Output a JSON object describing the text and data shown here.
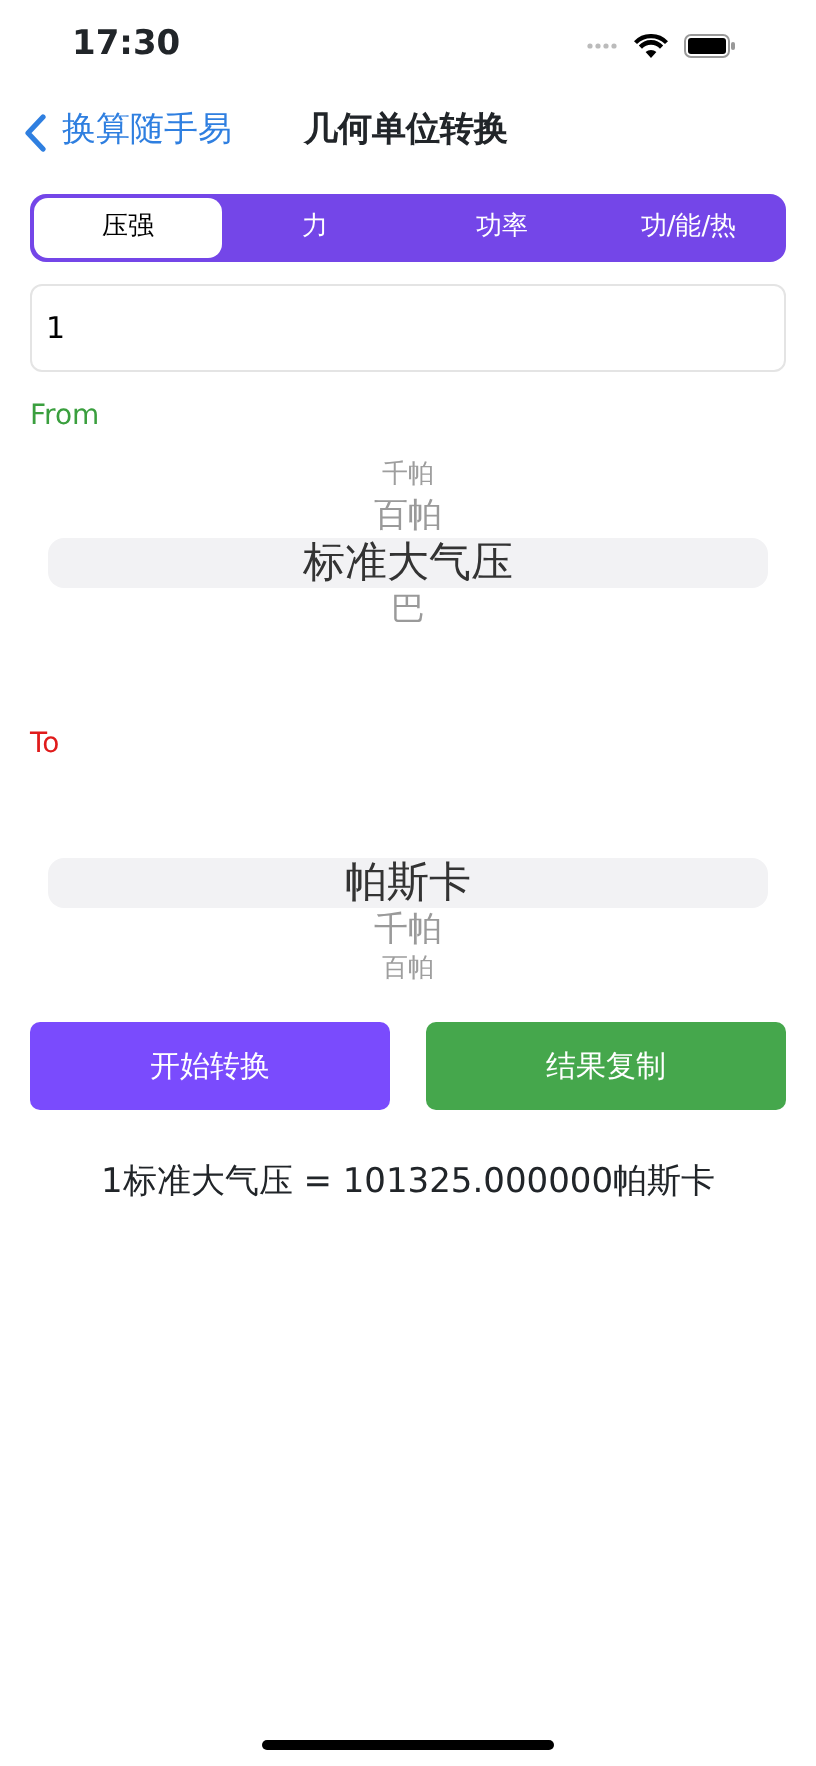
{
  "status_bar": {
    "time": "17:30"
  },
  "nav": {
    "back_label": "换算随手易",
    "title": "几何单位转换"
  },
  "tabs": [
    {
      "label": "压强",
      "selected": true
    },
    {
      "label": "力",
      "selected": false
    },
    {
      "label": "功率",
      "selected": false
    },
    {
      "label": "功/能/热",
      "selected": false
    }
  ],
  "input": {
    "value": "1"
  },
  "from": {
    "label": "From",
    "items": [
      {
        "text": "千帕",
        "kind": "far"
      },
      {
        "text": "百帕",
        "kind": "near"
      },
      {
        "text": "标准大气压",
        "kind": "selected"
      },
      {
        "text": "巴",
        "kind": "near"
      }
    ]
  },
  "to": {
    "label": "To",
    "items": [
      {
        "text": "帕斯卡",
        "kind": "selected"
      },
      {
        "text": "千帕",
        "kind": "near"
      },
      {
        "text": "百帕",
        "kind": "far"
      }
    ]
  },
  "buttons": [
    {
      "label": "开始转换",
      "kind": "primary"
    },
    {
      "label": "结果复制",
      "kind": "success"
    }
  ],
  "result": "1标准大气压 = 101325.000000帕斯卡"
}
